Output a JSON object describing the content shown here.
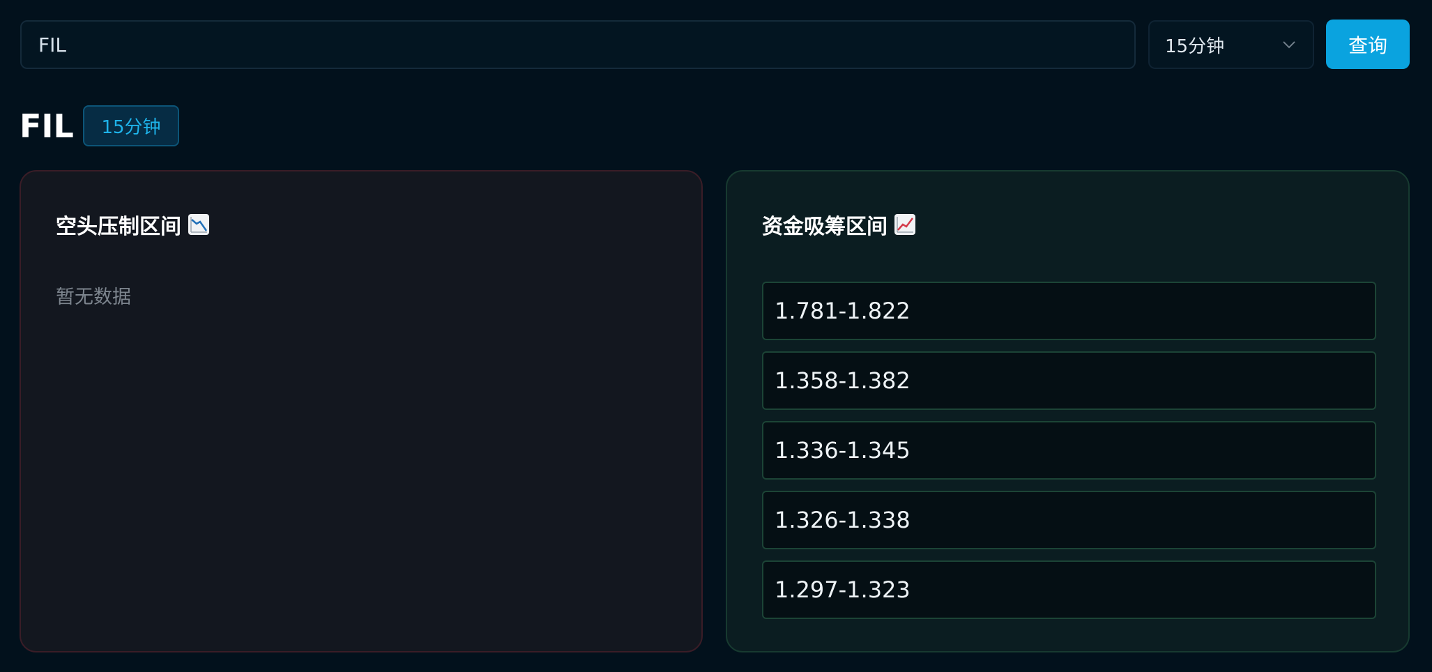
{
  "search": {
    "value": "FIL"
  },
  "interval_select": {
    "selected": "15分钟"
  },
  "query_button": {
    "label": "查询"
  },
  "header": {
    "symbol": "FIL",
    "interval_badge": "15分钟"
  },
  "bear_panel": {
    "title": "空头压制区间",
    "icon": "chart-decreasing-icon",
    "empty_text": "暂无数据"
  },
  "bull_panel": {
    "title": "资金吸筹区间",
    "icon": "chart-increasing-icon",
    "ranges": [
      "1.781-1.822",
      "1.358-1.382",
      "1.336-1.345",
      "1.326-1.338",
      "1.297-1.323"
    ]
  },
  "colors": {
    "background": "#02111c",
    "accent": "#0aa3df",
    "bear_border": "#3a1d27",
    "bull_border": "#173a30"
  }
}
